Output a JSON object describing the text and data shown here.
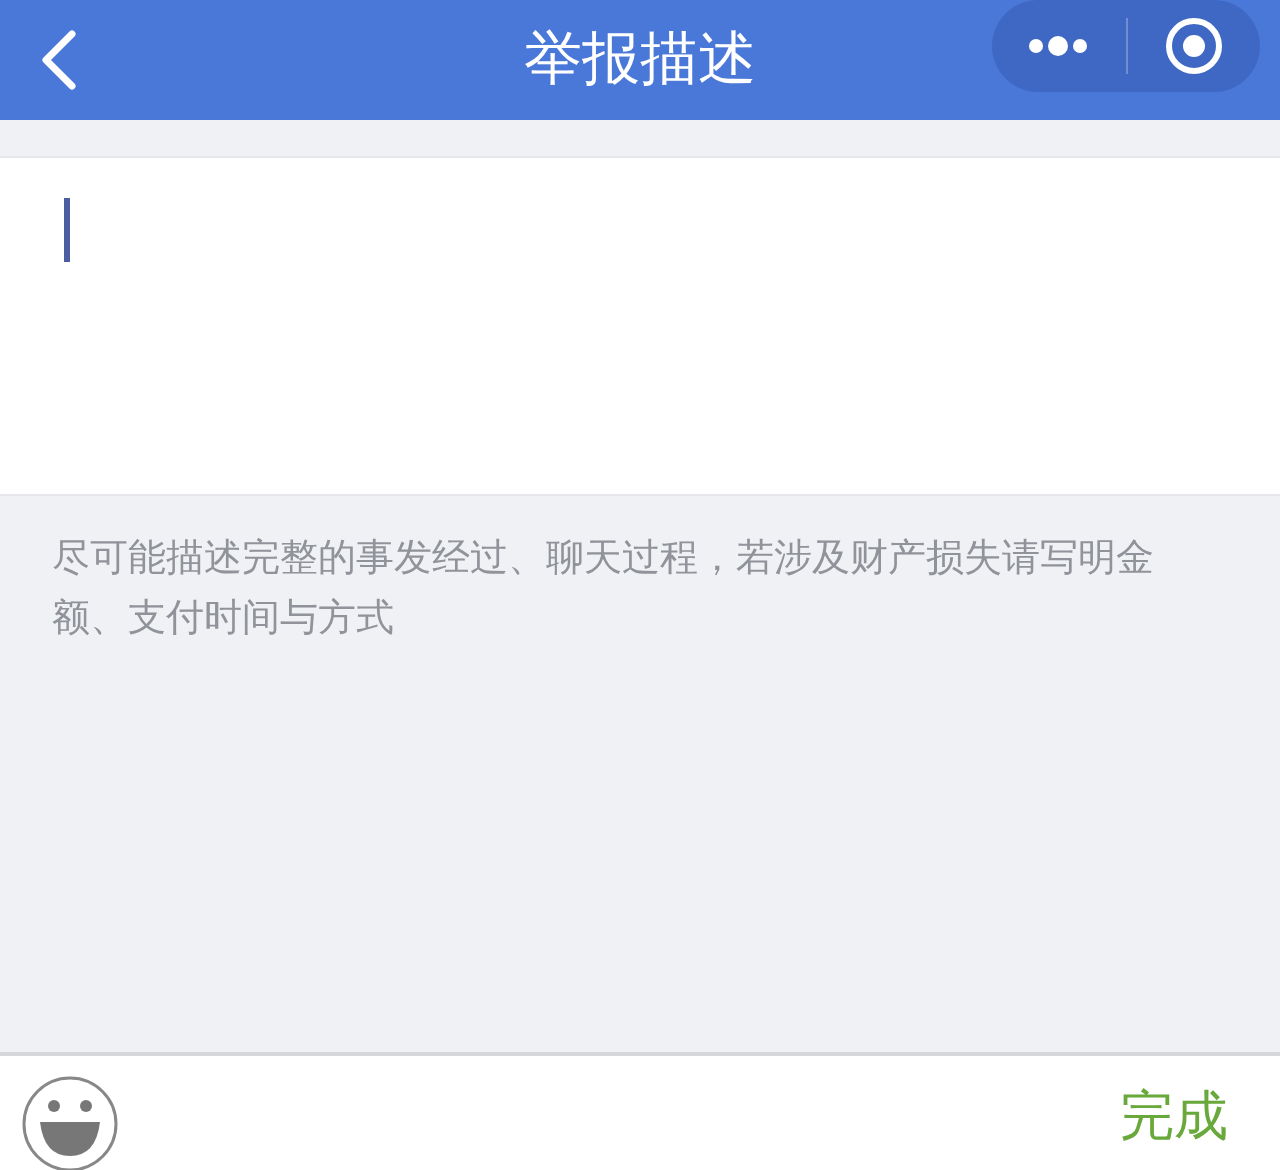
{
  "nav_bar": {
    "title": "举报描述"
  },
  "description_field": {
    "focused": true
  },
  "hint": "尽可能描述完整的事发经过、聊天过程，若涉及财产损失请写明金额、支付时间与方式",
  "bottom_bar": {
    "done_button": "完成"
  }
}
